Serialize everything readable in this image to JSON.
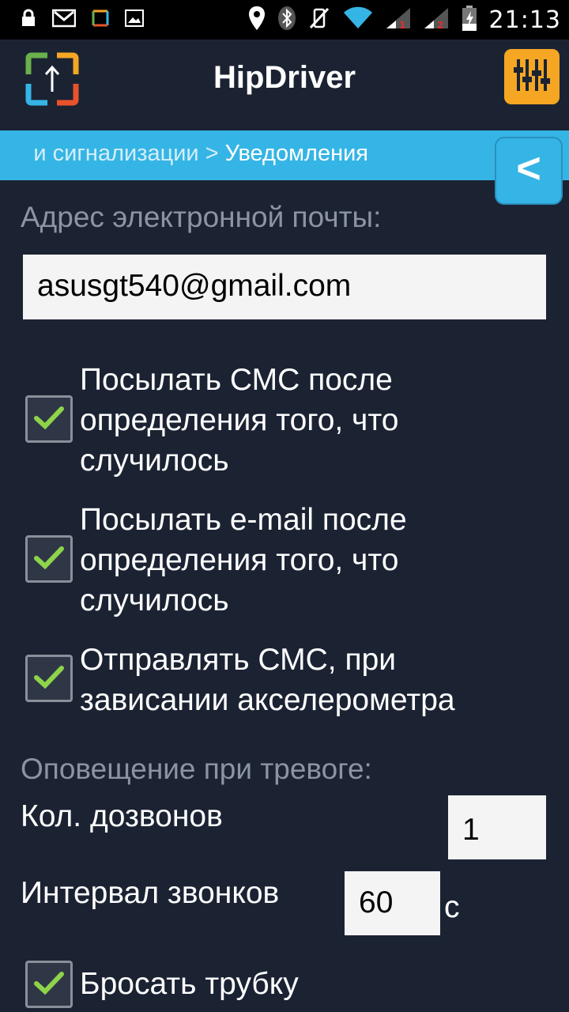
{
  "status_bar": {
    "time": "21:13",
    "left_icons": [
      "lock-icon",
      "gmail-icon",
      "notification-app-icon",
      "gallery-icon"
    ],
    "right_icons": [
      "location-icon",
      "bluetooth-icon",
      "vibrate-off-icon",
      "wifi-icon",
      "signal-sim1-icon",
      "signal-sim2-icon",
      "battery-charging-icon"
    ]
  },
  "header": {
    "title": "HipDriver",
    "logo_icon": "hipdriver-logo-icon",
    "settings_icon": "equalizer-settings-icon"
  },
  "breadcrumb": {
    "path": "и сигнализации > ",
    "current": "Уведомления",
    "back_label": "<"
  },
  "form": {
    "email_label": "Адрес электронной почты:",
    "email_value": "asusgt540@gmail.com",
    "checkboxes": [
      {
        "lines": [
          "Посылать СМС после",
          "определения того, что",
          "случилось"
        ],
        "checked": true
      },
      {
        "lines": [
          "Посылать e-mail после",
          "определения того, что",
          "случилось"
        ],
        "checked": true
      },
      {
        "lines": [
          "Отправлять СМС, при",
          "зависании акселерометра"
        ],
        "checked": true
      }
    ],
    "alarm_section_label": "Оповещение при тревоге:",
    "call_count_label": "Кол. дозвонов",
    "call_count_value": "1",
    "call_interval_label": "Интервал звонков",
    "call_interval_value": "60",
    "call_interval_unit": "с",
    "hang_up_label": "Бросать трубку",
    "hang_up_checked": true
  },
  "colors": {
    "background": "#1b2333",
    "accent_blue": "#35b5e5",
    "accent_orange": "#f5a623",
    "check_green": "#8ed44a"
  }
}
